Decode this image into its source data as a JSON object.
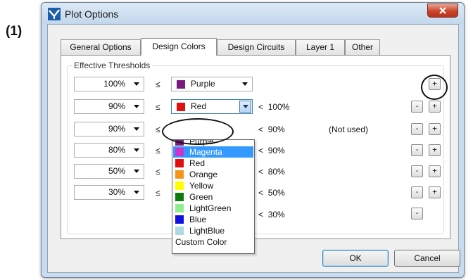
{
  "step_label": "(1)",
  "window": {
    "title": "Plot Options",
    "icons": {
      "app": "plot-app-icon",
      "close": "close-x-icon"
    }
  },
  "tabs": [
    {
      "label": "General Options",
      "active": false
    },
    {
      "label": "Design Colors",
      "active": true
    },
    {
      "label": "Design Circuits",
      "active": false
    },
    {
      "label": "Layer 1",
      "active": false
    },
    {
      "label": "Other",
      "active": false
    }
  ],
  "group_label": "Effective Thresholds",
  "le_symbol": "≤",
  "lt_symbol": "<",
  "rows": [
    {
      "threshold": "100%",
      "color": "Purple",
      "color_hex": "#7b1a7e",
      "upper": "",
      "note": ""
    },
    {
      "threshold": "90%",
      "color": "Red",
      "color_hex": "#e11010",
      "upper": "100%",
      "note": ""
    },
    {
      "threshold": "90%",
      "color": "",
      "color_hex": "",
      "upper": "90%",
      "note": "(Not used)"
    },
    {
      "threshold": "80%",
      "color": "",
      "color_hex": "",
      "upper": "90%",
      "note": ""
    },
    {
      "threshold": "50%",
      "color": "",
      "color_hex": "",
      "upper": "80%",
      "note": ""
    },
    {
      "threshold": "30%",
      "color": "",
      "color_hex": "",
      "upper": "50%",
      "note": ""
    },
    {
      "threshold": "",
      "color": "",
      "color_hex": "",
      "upper": "30%",
      "note": ""
    }
  ],
  "mini_buttons": {
    "minus": "-",
    "plus": "+"
  },
  "dropdown_options": [
    {
      "label": "Purple",
      "hex": "#7b1a7e"
    },
    {
      "label": "Magenta",
      "hex": "#cc33cc"
    },
    {
      "label": "Red",
      "hex": "#e11010"
    },
    {
      "label": "Orange",
      "hex": "#f7941d"
    },
    {
      "label": "Yellow",
      "hex": "#ffff00"
    },
    {
      "label": "Green",
      "hex": "#0e7a0e"
    },
    {
      "label": "LightGreen",
      "hex": "#90ee90"
    },
    {
      "label": "Blue",
      "hex": "#1010e0"
    },
    {
      "label": "LightBlue",
      "hex": "#add8e6"
    },
    {
      "label": "Custom Color",
      "hex": ""
    }
  ],
  "selected_option": "Magenta",
  "buttons": {
    "ok": "OK",
    "cancel": "Cancel"
  },
  "colors": {
    "selection": "#3399ff",
    "title_bar": "#c9dcef",
    "close_button": "#c9442b"
  }
}
